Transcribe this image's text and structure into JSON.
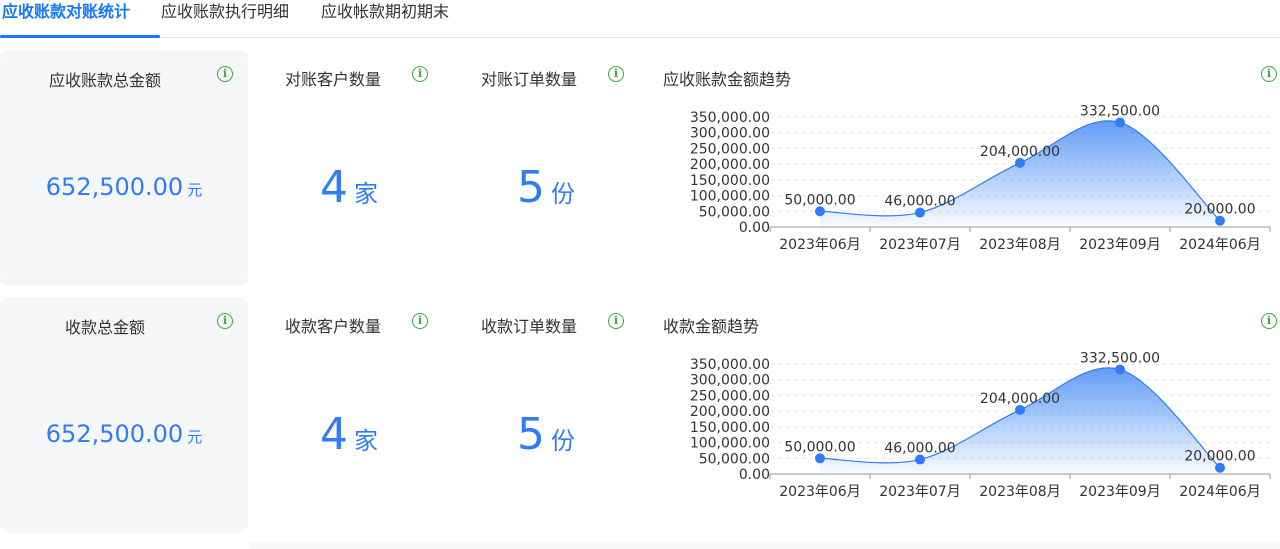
{
  "tabs": [
    {
      "label": "应收账款对账统计",
      "active": true
    },
    {
      "label": "应收账款执行明细",
      "active": false
    },
    {
      "label": "应收帐款期初期末",
      "active": false
    }
  ],
  "sections": [
    {
      "total": {
        "title": "应收账款总金额",
        "amount": "652,500.00",
        "unit": "元"
      },
      "customers": {
        "title": "对账客户数量",
        "value": "4",
        "unit": "家"
      },
      "orders": {
        "title": "对账订单数量",
        "value": "5",
        "unit": "份"
      },
      "chart_title": "应收账款金额趋势"
    },
    {
      "total": {
        "title": "收款总金额",
        "amount": "652,500.00",
        "unit": "元"
      },
      "customers": {
        "title": "收款客户数量",
        "value": "4",
        "unit": "家"
      },
      "orders": {
        "title": "收款订单数量",
        "value": "5",
        "unit": "份"
      },
      "chart_title": "收款金额趋势"
    }
  ],
  "colors": {
    "accent": "#2f7cf6",
    "info": "#3aab3a",
    "card_bg": "#f5f6f8"
  },
  "icons": {
    "info": "info-circle-icon"
  },
  "chart_data": [
    {
      "type": "area",
      "title": "应收账款金额趋势",
      "categories": [
        "2023年06月",
        "2023年07月",
        "2023年08月",
        "2023年09月",
        "2024年06月"
      ],
      "values": [
        50000,
        46000,
        204000,
        332500,
        20000
      ],
      "value_labels": [
        "50,000.00",
        "46,000.00",
        "204,000.00",
        "332,500.00",
        "20,000.00"
      ],
      "yticks": [
        "0.00",
        "50,000.00",
        "100,000.00",
        "150,000.00",
        "200,000.00",
        "250,000.00",
        "300,000.00",
        "350,000.00"
      ],
      "ylim": [
        0,
        350000
      ],
      "grid": true,
      "smooth": true
    },
    {
      "type": "area",
      "title": "收款金额趋势",
      "categories": [
        "2023年06月",
        "2023年07月",
        "2023年08月",
        "2023年09月",
        "2024年06月"
      ],
      "values": [
        50000,
        46000,
        204000,
        332500,
        20000
      ],
      "value_labels": [
        "50,000.00",
        "46,000.00",
        "204,000.00",
        "332,500.00",
        "20,000.00"
      ],
      "yticks": [
        "0.00",
        "50,000.00",
        "100,000.00",
        "150,000.00",
        "200,000.00",
        "250,000.00",
        "300,000.00",
        "350,000.00"
      ],
      "ylim": [
        0,
        350000
      ],
      "grid": true,
      "smooth": true
    }
  ]
}
